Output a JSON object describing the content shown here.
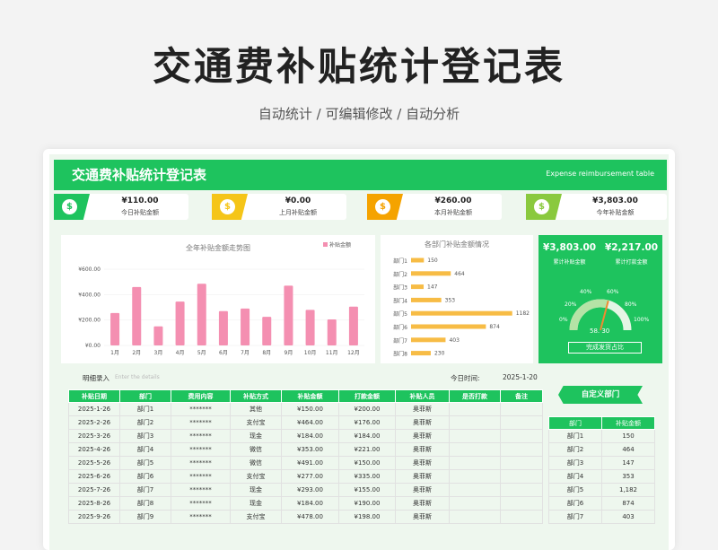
{
  "hero": {
    "title": "交通费补贴统计登记表",
    "subtitle": "自动统计 /  可编辑修改  / 自动分析"
  },
  "banner": {
    "title": "交通费补贴统计登记表",
    "subtitle_en": "Expense reimbursement table"
  },
  "stats": [
    {
      "value": "¥110.00",
      "label": "今日补贴金额",
      "color": "#1ec35e",
      "icon": "dollar-coin-icon"
    },
    {
      "value": "¥0.00",
      "label": "上月补贴金额",
      "color": "#f5c518",
      "icon": "dollar-coin-icon"
    },
    {
      "value": "¥260.00",
      "label": "本月补贴金额",
      "color": "#f5a300",
      "icon": "dollar-coin-icon"
    },
    {
      "value": "¥3,803.00",
      "label": "今年补贴金额",
      "color": "#8ac93e",
      "icon": "dollar-coin-icon"
    }
  ],
  "colors": {
    "accent": "#1ec35e",
    "bar_pink": "#f48fb1",
    "bar_orange": "#f7bc45"
  },
  "chart_data": [
    {
      "type": "bar",
      "title": "全年补贴金额走势图",
      "legend": [
        "补贴金额"
      ],
      "categories": [
        "1月",
        "2月",
        "3月",
        "4月",
        "5月",
        "6月",
        "7月",
        "8月",
        "9月",
        "10月",
        "11月",
        "12月"
      ],
      "values": [
        255,
        460,
        150,
        345,
        485,
        270,
        290,
        225,
        470,
        280,
        205,
        305
      ],
      "ylim": [
        0,
        600
      ],
      "yticks": [
        "¥0.00",
        "¥200.00",
        "¥400.00",
        "¥600.00"
      ]
    },
    {
      "type": "bar",
      "orientation": "horizontal",
      "title": "各部门补贴金额情况",
      "categories": [
        "部门1",
        "部门2",
        "部门3",
        "部门4",
        "部门5",
        "部门6",
        "部门7",
        "部门8"
      ],
      "values": [
        150,
        464,
        147,
        353,
        1182,
        874,
        403,
        230
      ],
      "xlim": [
        0,
        1300
      ]
    }
  ],
  "summary": {
    "total_value": "¥3,803.00",
    "total_label": "累计补贴金额",
    "paid_value": "¥2,217.00",
    "paid_label": "累计打款金额",
    "gauge_value": 58.3,
    "gauge_value_text": "58. 30",
    "gauge_ticks": [
      "0%",
      "20%",
      "40%",
      "60%",
      "80%",
      "100%"
    ],
    "gauge_button": "完成发货占比"
  },
  "detail": {
    "label": "明细录入",
    "placeholder": "Enter the details",
    "date_label": "今日时间:",
    "date_value": "2025-1-20"
  },
  "table": {
    "headers": [
      "补贴日期",
      "部门",
      "费用内容",
      "补贴方式",
      "补贴金额",
      "打款金额",
      "补贴人员",
      "是否打款",
      "备注"
    ],
    "rows": [
      [
        "2025-1-26",
        "部门1",
        "*******",
        "其他",
        "¥150.00",
        "¥200.00",
        "奥菲斯",
        "",
        ""
      ],
      [
        "2025-2-26",
        "部门2",
        "*******",
        "支付宝",
        "¥464.00",
        "¥176.00",
        "奥菲斯",
        "",
        ""
      ],
      [
        "2025-3-26",
        "部门3",
        "*******",
        "现金",
        "¥184.00",
        "¥184.00",
        "奥菲斯",
        "",
        ""
      ],
      [
        "2025-4-26",
        "部门4",
        "*******",
        "微信",
        "¥353.00",
        "¥221.00",
        "奥菲斯",
        "",
        ""
      ],
      [
        "2025-5-26",
        "部门5",
        "*******",
        "微信",
        "¥491.00",
        "¥150.00",
        "奥菲斯",
        "",
        ""
      ],
      [
        "2025-6-26",
        "部门6",
        "*******",
        "支付宝",
        "¥277.00",
        "¥335.00",
        "奥菲斯",
        "",
        ""
      ],
      [
        "2025-7-26",
        "部门7",
        "*******",
        "现金",
        "¥293.00",
        "¥155.00",
        "奥菲斯",
        "",
        ""
      ],
      [
        "2025-8-26",
        "部门8",
        "*******",
        "现金",
        "¥184.00",
        "¥190.00",
        "奥菲斯",
        "",
        ""
      ],
      [
        "2025-9-26",
        "部门9",
        "*******",
        "支付宝",
        "¥478.00",
        "¥198.00",
        "奥菲斯",
        "",
        ""
      ]
    ]
  },
  "side": {
    "title": "自定义部门",
    "headers": [
      "部门",
      "补贴金额"
    ],
    "rows": [
      [
        "部门1",
        "150"
      ],
      [
        "部门2",
        "464"
      ],
      [
        "部门3",
        "147"
      ],
      [
        "部门4",
        "353"
      ],
      [
        "部门5",
        "1,182"
      ],
      [
        "部门6",
        "874"
      ],
      [
        "部门7",
        "403"
      ]
    ]
  }
}
